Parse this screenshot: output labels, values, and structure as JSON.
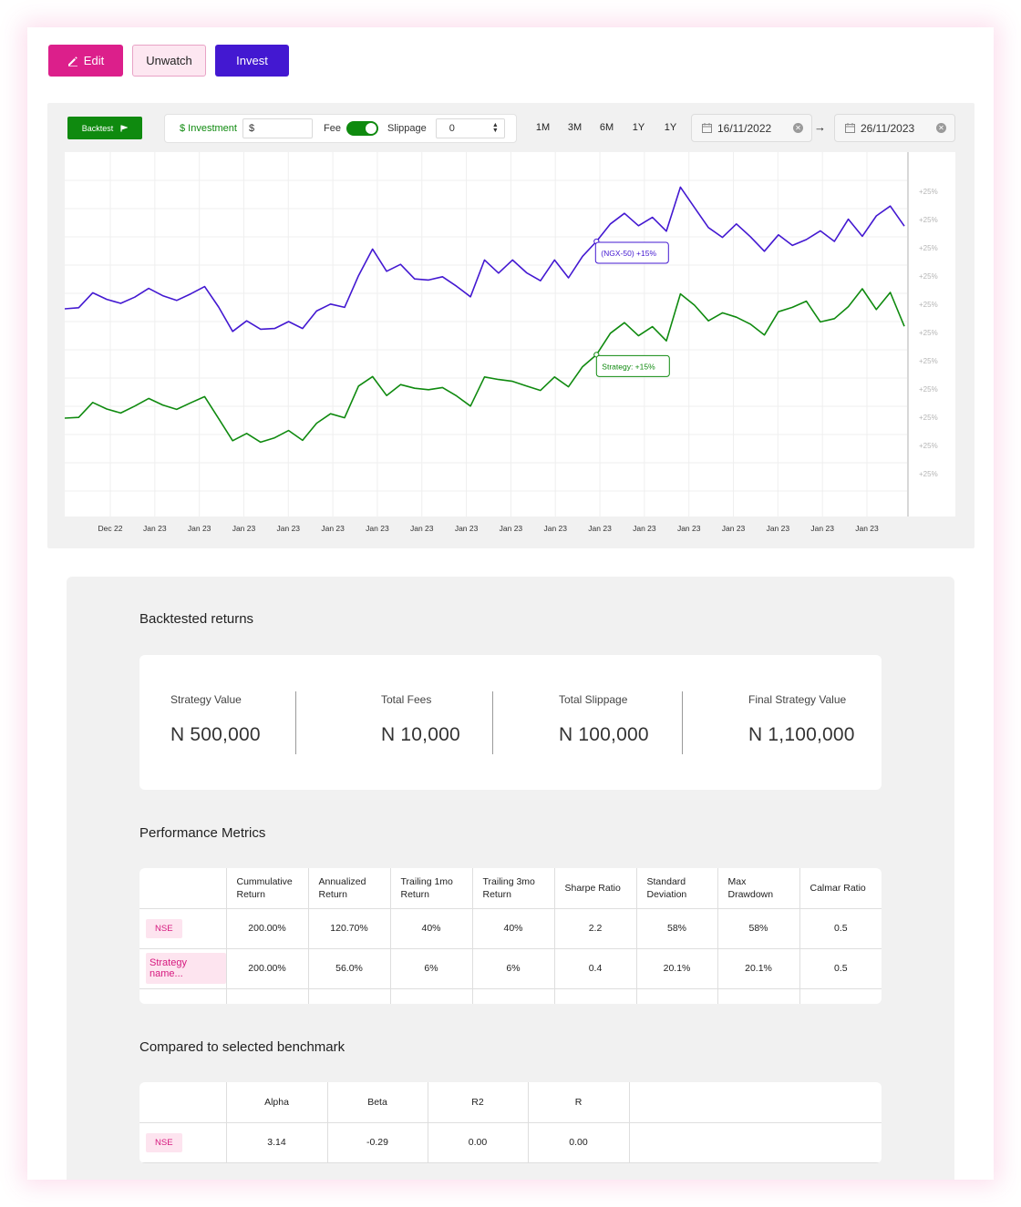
{
  "actions": {
    "edit_label": "Edit",
    "unwatch_label": "Unwatch",
    "invest_label": "Invest"
  },
  "toolbar": {
    "backtest_label": "Backtest",
    "investment_label": "$ Investment",
    "investment_value": "$",
    "fee_label": "Fee",
    "fee_enabled": true,
    "slippage_label": "Slippage",
    "slippage_value": "0",
    "ranges": [
      "1M",
      "3M",
      "6M",
      "1Y",
      "1Y"
    ],
    "start_date": "16/11/2022",
    "end_date": "26/11/2023",
    "date_arrow": "→"
  },
  "chart_data": {
    "type": "line",
    "x_tick_labels": [
      "Dec 22",
      "Jan 23",
      "Jan 23",
      "Jan 23",
      "Jan 23",
      "Jan 23",
      "Jan 23",
      "Jan 23",
      "Jan 23",
      "Jan 23",
      "Jan 23",
      "Jan 23",
      "Jan 23",
      "Jan 23",
      "Jan 23",
      "Jan 23",
      "Jan 23",
      "Jan 23"
    ],
    "y_tick_labels": [
      "+25%",
      "+25%",
      "+25%",
      "+25%",
      "+25%",
      "+25%",
      "+25%",
      "+25%",
      "+25%",
      "+25%",
      "+25%"
    ],
    "y_range": [
      0,
      100
    ],
    "grid": true,
    "series": [
      {
        "name": "NGX-50",
        "color": "#4318d1",
        "tooltip": "(NGX-50)   +15%",
        "tooltip_index": 38,
        "values": [
          57,
          57.3,
          61.4,
          59.6,
          58.5,
          60.2,
          62.6,
          60.6,
          59.3,
          61.1,
          63.1,
          57.5,
          50.8,
          53.7,
          51.4,
          51.6,
          53.5,
          51.6,
          56.4,
          58.3,
          57.4,
          66.1,
          73.4,
          67.3,
          69.2,
          65.2,
          64.9,
          65.8,
          63.2,
          60.3,
          70.4,
          66.8,
          70.4,
          66.9,
          64.7,
          70.4,
          65.5,
          71.4,
          75.5,
          80.3,
          83.2,
          79.8,
          82.1,
          78.3,
          90.4,
          84.8,
          79.3,
          76.6,
          80.3,
          76.8,
          72.8,
          77.3,
          74.4,
          76,
          78.4,
          75.5,
          81.6,
          76.9,
          82.5,
          85.2,
          79.7
        ],
        "values_note": "read as percent of plot height"
      },
      {
        "name": "Strategy",
        "color": "#0f8a0f",
        "tooltip": "Strategy:   +15%",
        "tooltip_index": 38,
        "values": [
          27,
          27.2,
          31.3,
          29.5,
          28.4,
          30.3,
          32.4,
          30.6,
          29.4,
          31.2,
          32.9,
          26.9,
          20.8,
          22.8,
          20.4,
          21.6,
          23.6,
          20.9,
          25.6,
          28.2,
          27.1,
          35.8,
          38.4,
          33.2,
          36.2,
          35.2,
          34.8,
          35.4,
          33.1,
          30.3,
          38.3,
          37.6,
          37.1,
          35.8,
          34.6,
          38.3,
          35.6,
          41.1,
          44.4,
          50.3,
          53.2,
          49.6,
          52.1,
          48.2,
          61.1,
          58,
          53.7,
          55.9,
          54.7,
          52.8,
          49.8,
          56.2,
          57.4,
          59.1,
          53.4,
          54.3,
          57.6,
          62.5,
          56.8,
          61.5,
          52.2
        ]
      }
    ]
  },
  "backtested": {
    "title": "Backtested returns",
    "items": [
      {
        "label": "Strategy Value",
        "value": "N 500,000"
      },
      {
        "label": "Total Fees",
        "value": "N 10,000"
      },
      {
        "label": "Total Slippage",
        "value": "N 100,000"
      },
      {
        "label": "Final Strategy Value",
        "value": "N 1,100,000"
      }
    ]
  },
  "performance": {
    "title": "Performance Metrics",
    "headers": [
      "",
      "Cummulative Return",
      "Annualized Return",
      "Trailing 1mo Return",
      "Trailing 3mo Return",
      "Sharpe Ratio",
      "Standard Deviation",
      "Max Drawdown",
      "Calmar Ratio"
    ],
    "rows": [
      {
        "name": "NSE",
        "cells": [
          "200.00%",
          "120.70%",
          "40%",
          "40%",
          "2.2",
          "58%",
          "58%",
          "0.5"
        ]
      },
      {
        "name": "Strategy name...",
        "cells": [
          "200.00%",
          "56.0%",
          "6%",
          "6%",
          "0.4",
          "20.1%",
          "20.1%",
          "0.5"
        ]
      }
    ]
  },
  "benchmark": {
    "title": "Compared to selected benchmark",
    "headers": [
      "",
      "Alpha",
      "Beta",
      "R2",
      "R",
      ""
    ],
    "rows": [
      {
        "name": "NSE",
        "cells": [
          "3.14",
          "-0.29",
          "0.00",
          "0.00",
          ""
        ]
      }
    ]
  },
  "icons": {
    "edit": "pencil-icon",
    "backtest": "flag-icon",
    "calendar": "calendar-icon",
    "clear": "clear-icon"
  }
}
